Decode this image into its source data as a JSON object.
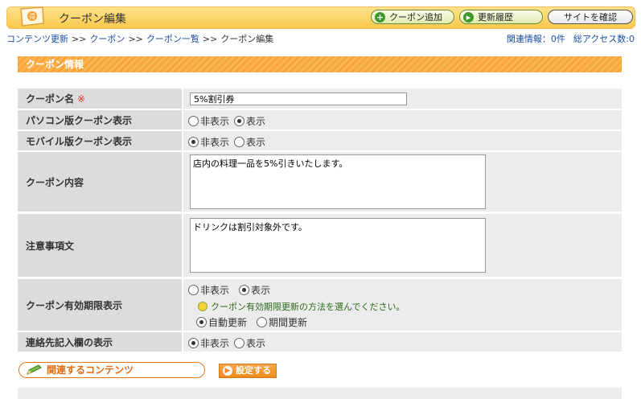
{
  "header": {
    "title": "クーポン編集",
    "buttons": {
      "add": "クーポン追加",
      "history": "更新履歴",
      "site": "サイトを確認"
    }
  },
  "breadcrumb": {
    "items": [
      "コンテンツ更新",
      "クーポン",
      "クーポン一覧"
    ],
    "separator": ">>",
    "current": "クーポン編集"
  },
  "stats": {
    "related": "関連情報：0件",
    "access": "総アクセス数:0"
  },
  "section": {
    "title": "クーポン情報"
  },
  "form": {
    "coupon_name": {
      "label": "クーポン名",
      "required_mark": "※",
      "value": "5%割引券"
    },
    "pc_display": {
      "label": "パソコン版クーポン表示",
      "options": [
        "非表示",
        "表示"
      ],
      "selected": "表示"
    },
    "mobile_display": {
      "label": "モバイル版クーポン表示",
      "options": [
        "非表示",
        "表示"
      ],
      "selected": "非表示"
    },
    "content": {
      "label": "クーポン内容",
      "value": "店内の料理一品を5%引きいたします。"
    },
    "notes": {
      "label": "注意事項文",
      "value": "ドリンクは割引対象外です。"
    },
    "expiry": {
      "label": "クーポン有効期限表示",
      "options": [
        "非表示",
        "表示"
      ],
      "selected": "表示",
      "hint": "クーポン有効期限更新の方法を選んでください。",
      "update_options": [
        "自動更新",
        "期間更新"
      ],
      "update_selected": "自動更新"
    },
    "contact": {
      "label": "連絡先記入欄の表示",
      "options": [
        "非表示",
        "表示"
      ],
      "selected": "非表示"
    }
  },
  "actions": {
    "related": "関連するコンテンツ",
    "save": "設定する"
  },
  "colors": {
    "header": "#f9c94c",
    "section": "#f7a53a",
    "label_bg": "#dcdcdc",
    "value_bg": "#ececec",
    "link": "#1a4ea2"
  }
}
